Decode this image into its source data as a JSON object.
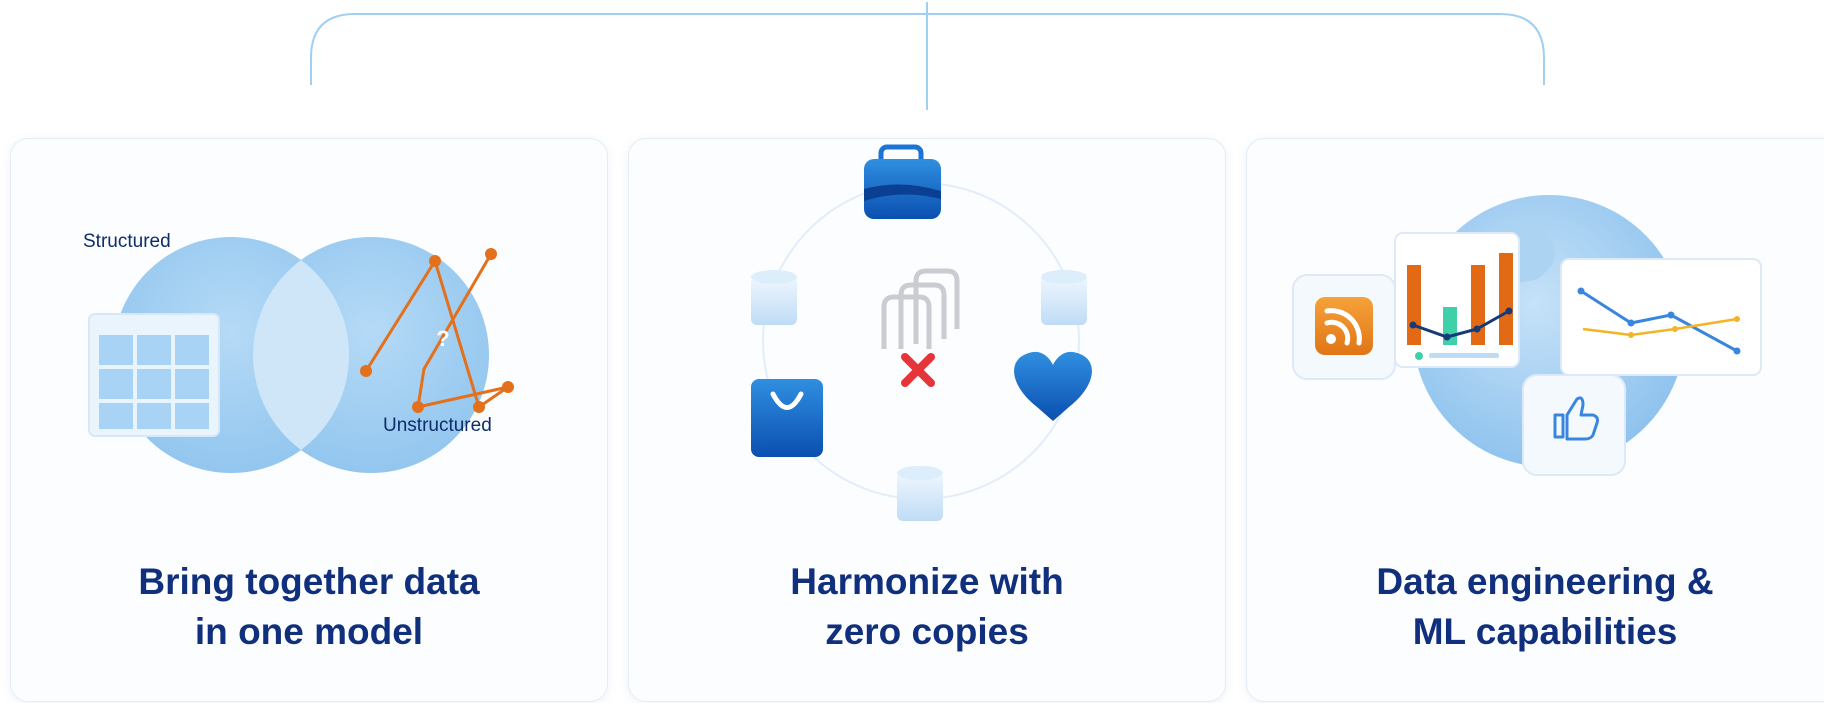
{
  "colors": {
    "title": "#10307e",
    "circle_blue": "#9fcdf1",
    "orange": "#e2701c",
    "red_x": "#e5353b",
    "border": "#e3edf8"
  },
  "cards": [
    {
      "title_line1": "Bring together data",
      "title_line2": "in one model",
      "label_structured": "Structured",
      "label_unstructured": "Unstructured",
      "question_mark": "?",
      "icons": [
        "venn-diagram",
        "table-icon",
        "network-graph-icon"
      ]
    },
    {
      "title_line1": "Harmonize with",
      "title_line2": "zero copies",
      "icons": [
        "briefcase-icon",
        "shopping-bag-icon",
        "heart-icon",
        "database-icon",
        "copy-icon",
        "x-icon"
      ]
    },
    {
      "title_line1": "Data engineering &",
      "title_line2": "ML capabilities",
      "icons": [
        "globe-icon",
        "rss-icon",
        "bar-chart-icon",
        "line-chart-icon",
        "thumbs-up-icon"
      ]
    }
  ]
}
